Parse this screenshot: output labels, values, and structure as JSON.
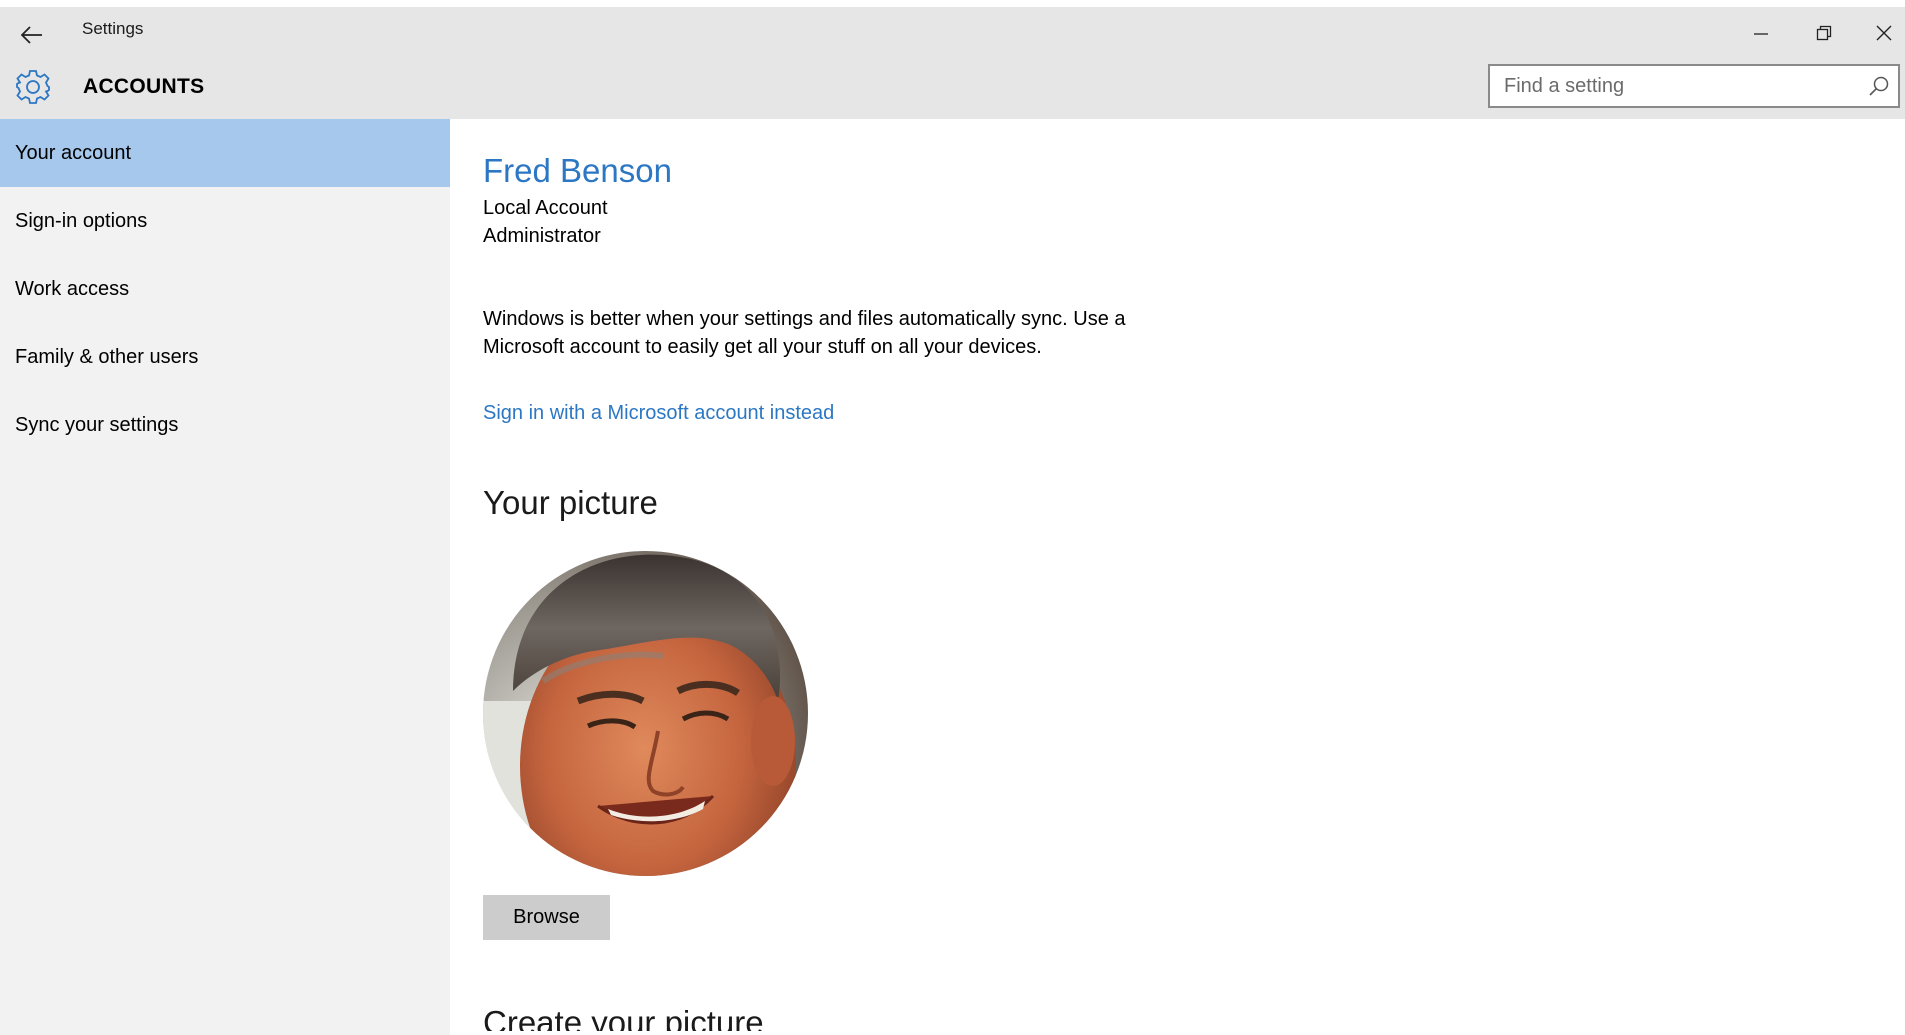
{
  "window": {
    "title": "Settings",
    "controls": [
      "minimize-icon",
      "restore-icon",
      "close-icon"
    ]
  },
  "header": {
    "section_title": "ACCOUNTS",
    "icon": "gear-icon",
    "search": {
      "placeholder": "Find a setting",
      "value": "",
      "icon": "search-icon"
    }
  },
  "sidebar": {
    "items": [
      {
        "label": "Your account",
        "selected": true
      },
      {
        "label": "Sign-in options",
        "selected": false
      },
      {
        "label": "Work access",
        "selected": false
      },
      {
        "label": "Family & other users",
        "selected": false
      },
      {
        "label": "Sync your settings",
        "selected": false
      }
    ]
  },
  "account": {
    "name": "Fred Benson",
    "type": "Local Account",
    "role": "Administrator",
    "sync_message": "Windows is better when your settings and files automatically sync. Use a Microsoft account to easily get all your stuff on all your devices.",
    "ms_link": "Sign in with a Microsoft account instead"
  },
  "picture": {
    "heading": "Your picture",
    "browse_label": "Browse"
  },
  "create_picture": {
    "heading": "Create your picture"
  },
  "colors": {
    "accent": "#2c77c4",
    "selected_nav": "#a6c8ec",
    "header_bg": "#e6e6e6",
    "sidebar_bg": "#f2f2f2"
  }
}
